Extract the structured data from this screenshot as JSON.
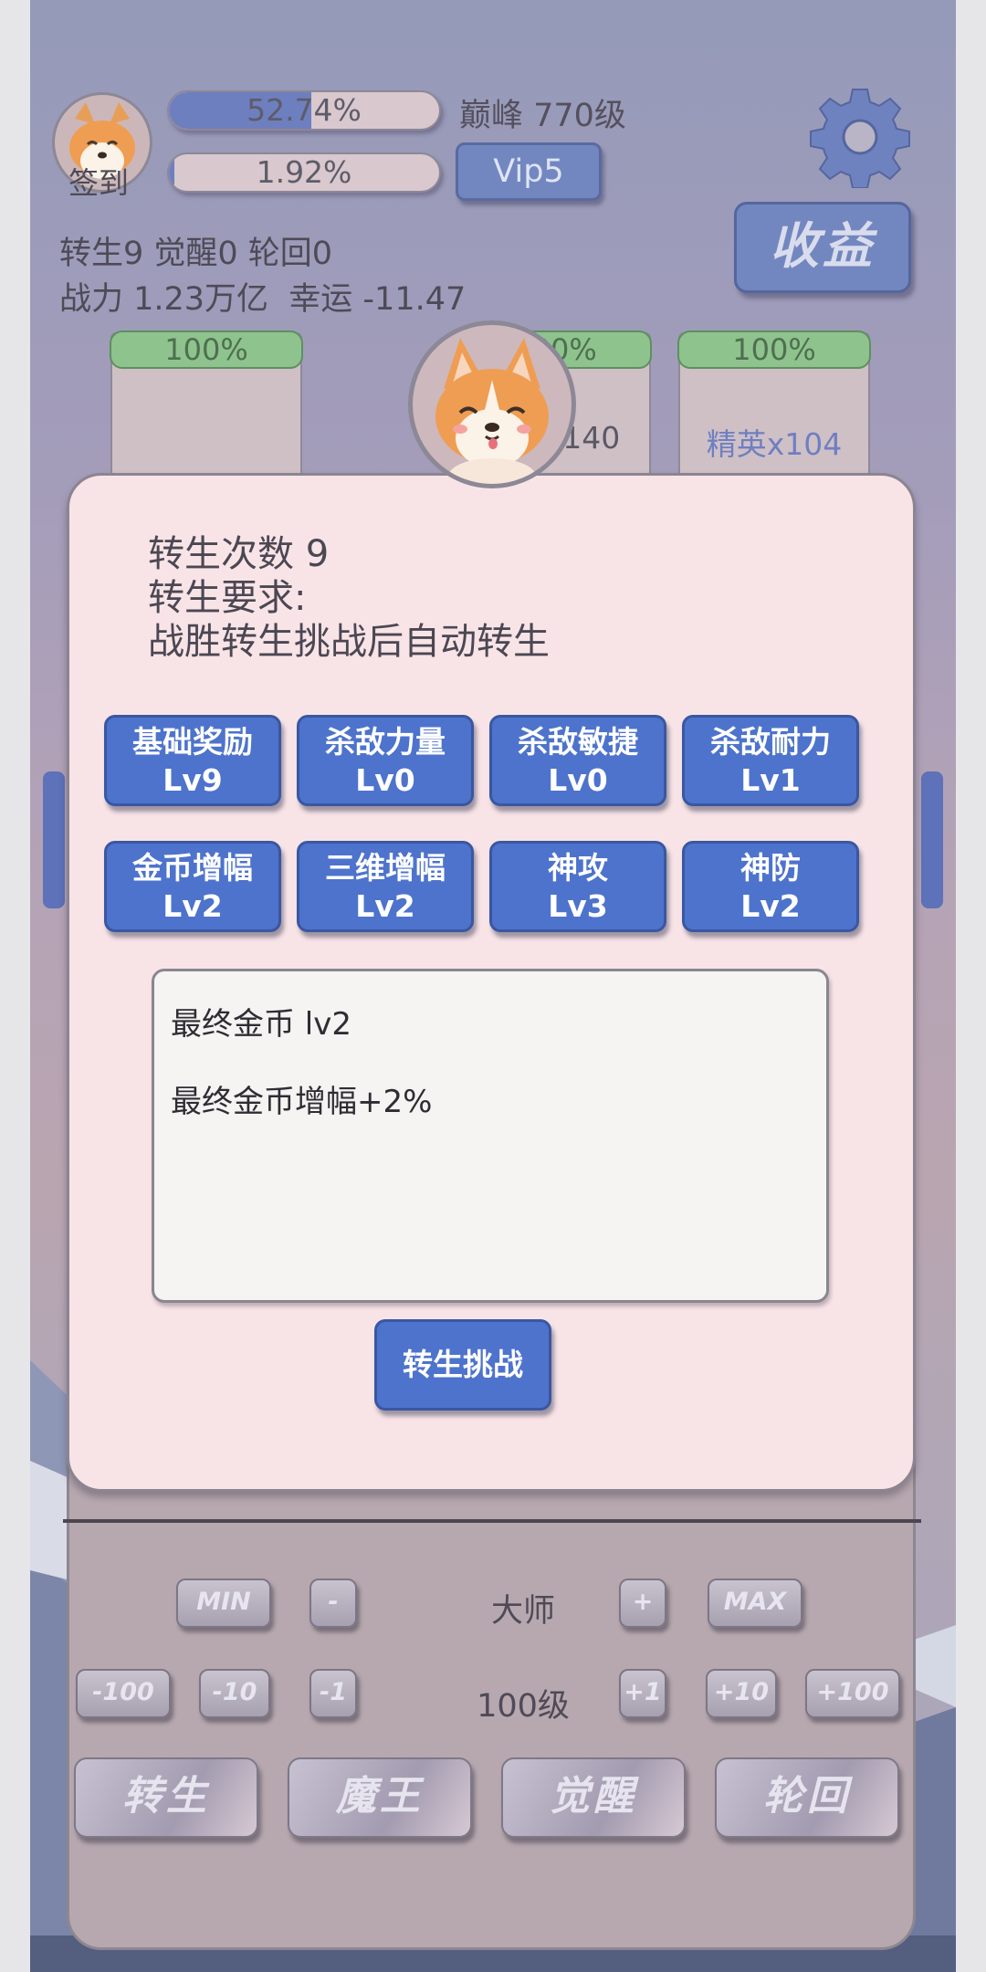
{
  "hud": {
    "signin_label": "签到",
    "exp_bar_text": "52.74%",
    "exp_fill": 0.5274,
    "second_bar_text": "1.92%",
    "second_fill": 0.0192,
    "peak_level": "巅峰 770级",
    "vip_label": "Vip5",
    "income_label": "收益",
    "status_line": "转生9 觉醒0 轮回0",
    "power_line": "战力 1.23万亿  幸运 -11.47"
  },
  "cards": [
    {
      "percent": "100%",
      "label": ""
    },
    {
      "percent": "100%",
      "label": "x140"
    },
    {
      "percent": "100%",
      "label": "精英x104"
    }
  ],
  "modal": {
    "rebirth_count": "转生次数 9",
    "requirement_title": "转生要求:",
    "requirement_text": "战胜转生挑战后自动转生",
    "skills": [
      {
        "name": "基础奖励",
        "level": "Lv9"
      },
      {
        "name": "杀敌力量",
        "level": "Lv0"
      },
      {
        "name": "杀敌敏捷",
        "level": "Lv0"
      },
      {
        "name": "杀敌耐力",
        "level": "Lv1"
      },
      {
        "name": "金币增幅",
        "level": "Lv2"
      },
      {
        "name": "三维增幅",
        "level": "Lv2"
      },
      {
        "name": "神攻",
        "level": "Lv3"
      },
      {
        "name": "神防",
        "level": "Lv2"
      }
    ],
    "desc_title": "最终金币 lv2",
    "desc_effect": "最终金币增幅+2%",
    "challenge_label": "转生挑战"
  },
  "controls": {
    "min_label": "MIN",
    "minus_label": "-",
    "difficulty": "大师",
    "plus_label": "+",
    "max_label": "MAX",
    "minus100": "-100",
    "minus10": "-10",
    "minus1": "-1",
    "level": "100级",
    "plus1": "+1",
    "plus10": "+10",
    "plus100": "+100"
  },
  "bottom_tabs": [
    "转生",
    "魔王",
    "觉醒",
    "轮回"
  ],
  "colors": {
    "accent_blue": "#4d73cc",
    "modal_bg": "#f8e4e7",
    "progress_green": "#8ec38d"
  }
}
